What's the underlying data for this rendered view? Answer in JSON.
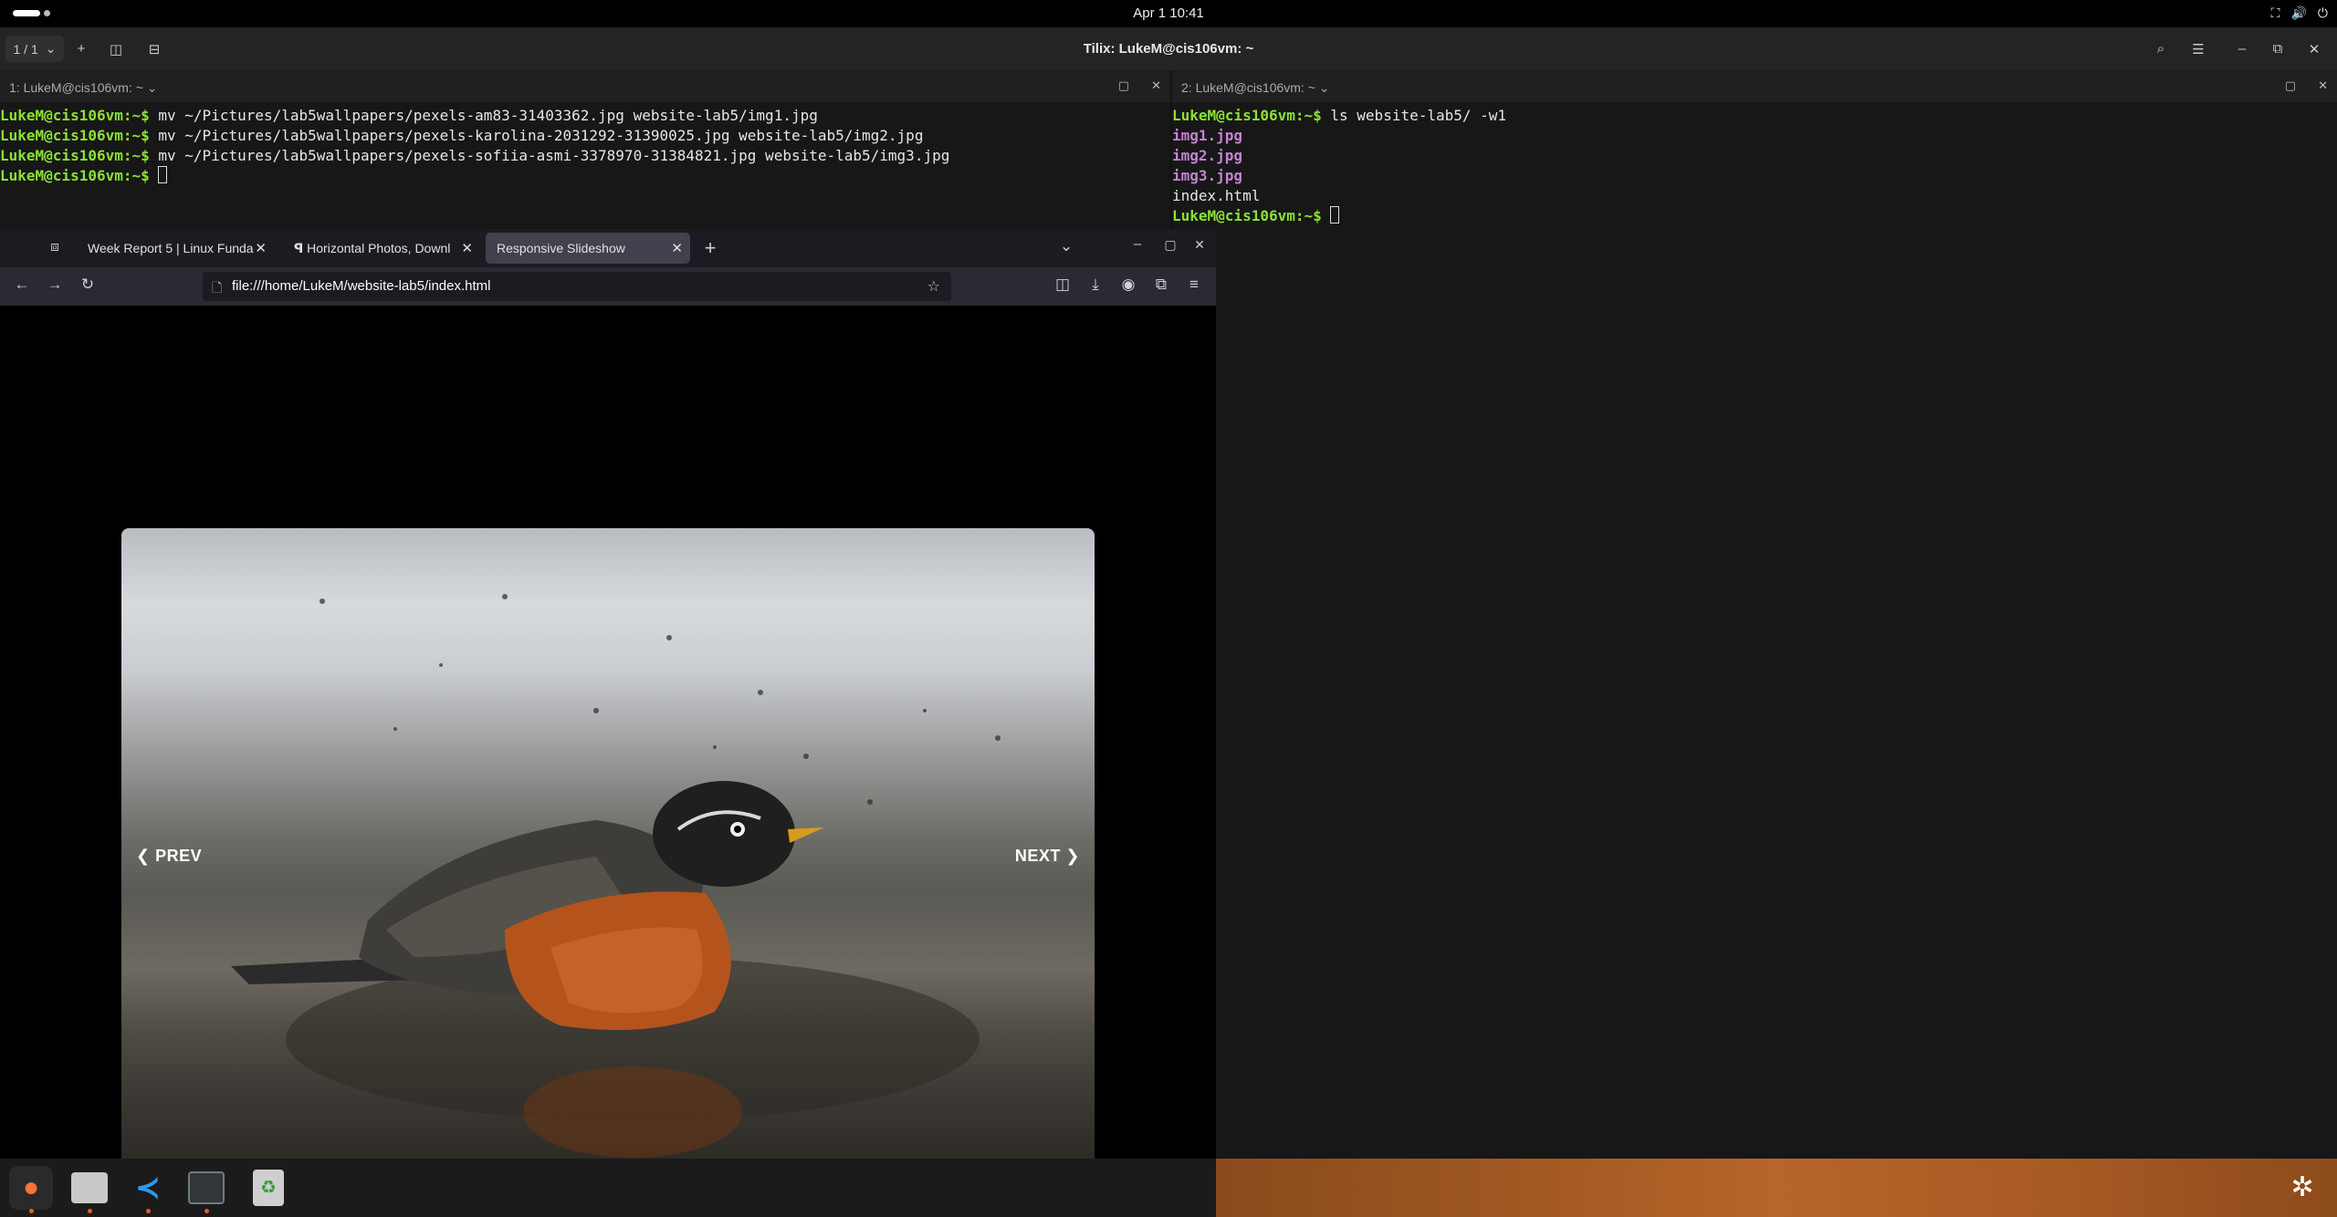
{
  "topbar": {
    "clock": "Apr 1  10:41"
  },
  "tilix": {
    "session_label": "1 / 1",
    "window_title": "Tilix: LukeM@cis106vm: ~",
    "left_pane": {
      "title": "1: LukeM@cis106vm: ~",
      "lines": [
        {
          "prompt": "LukeM@cis106vm",
          "cwd": ":~$ ",
          "cmd": "mv ~/Pictures/lab5wallpapers/pexels-am83-31403362.jpg website-lab5/img1.jpg"
        },
        {
          "prompt": "LukeM@cis106vm",
          "cwd": ":~$ ",
          "cmd": "mv ~/Pictures/lab5wallpapers/pexels-karolina-2031292-31390025.jpg website-lab5/img2.jpg"
        },
        {
          "prompt": "LukeM@cis106vm",
          "cwd": ":~$ ",
          "cmd": "mv ~/Pictures/lab5wallpapers/pexels-sofiia-asmi-3378970-31384821.jpg website-lab5/img3.jpg"
        },
        {
          "prompt": "LukeM@cis106vm",
          "cwd": ":~$ ",
          "cmd": ""
        }
      ]
    },
    "right_pane": {
      "title": "2: LukeM@cis106vm: ~",
      "command": {
        "prompt": "LukeM@cis106vm",
        "cwd": ":~$ ",
        "cmd": "ls website-lab5/ -w1"
      },
      "output": [
        "img1.jpg",
        "img2.jpg",
        "img3.jpg",
        "index.html"
      ],
      "final_prompt": {
        "prompt": "LukeM@cis106vm",
        "cwd": ":~$ "
      }
    }
  },
  "firefox": {
    "tabs": [
      {
        "label": "Week Report 5 | Linux Funda"
      },
      {
        "label": "Horizontal Photos, Downl"
      },
      {
        "label": "Responsive Slideshow"
      }
    ],
    "url": "file:///home/LukeM/website-lab5/index.html",
    "slideshow": {
      "prev_label": "❮ PREV",
      "next_label": "NEXT ❯"
    }
  },
  "dock": {
    "apps": [
      "firefox-icon",
      "files-icon",
      "vscode-icon",
      "tilix-icon",
      "trash-icon"
    ]
  }
}
